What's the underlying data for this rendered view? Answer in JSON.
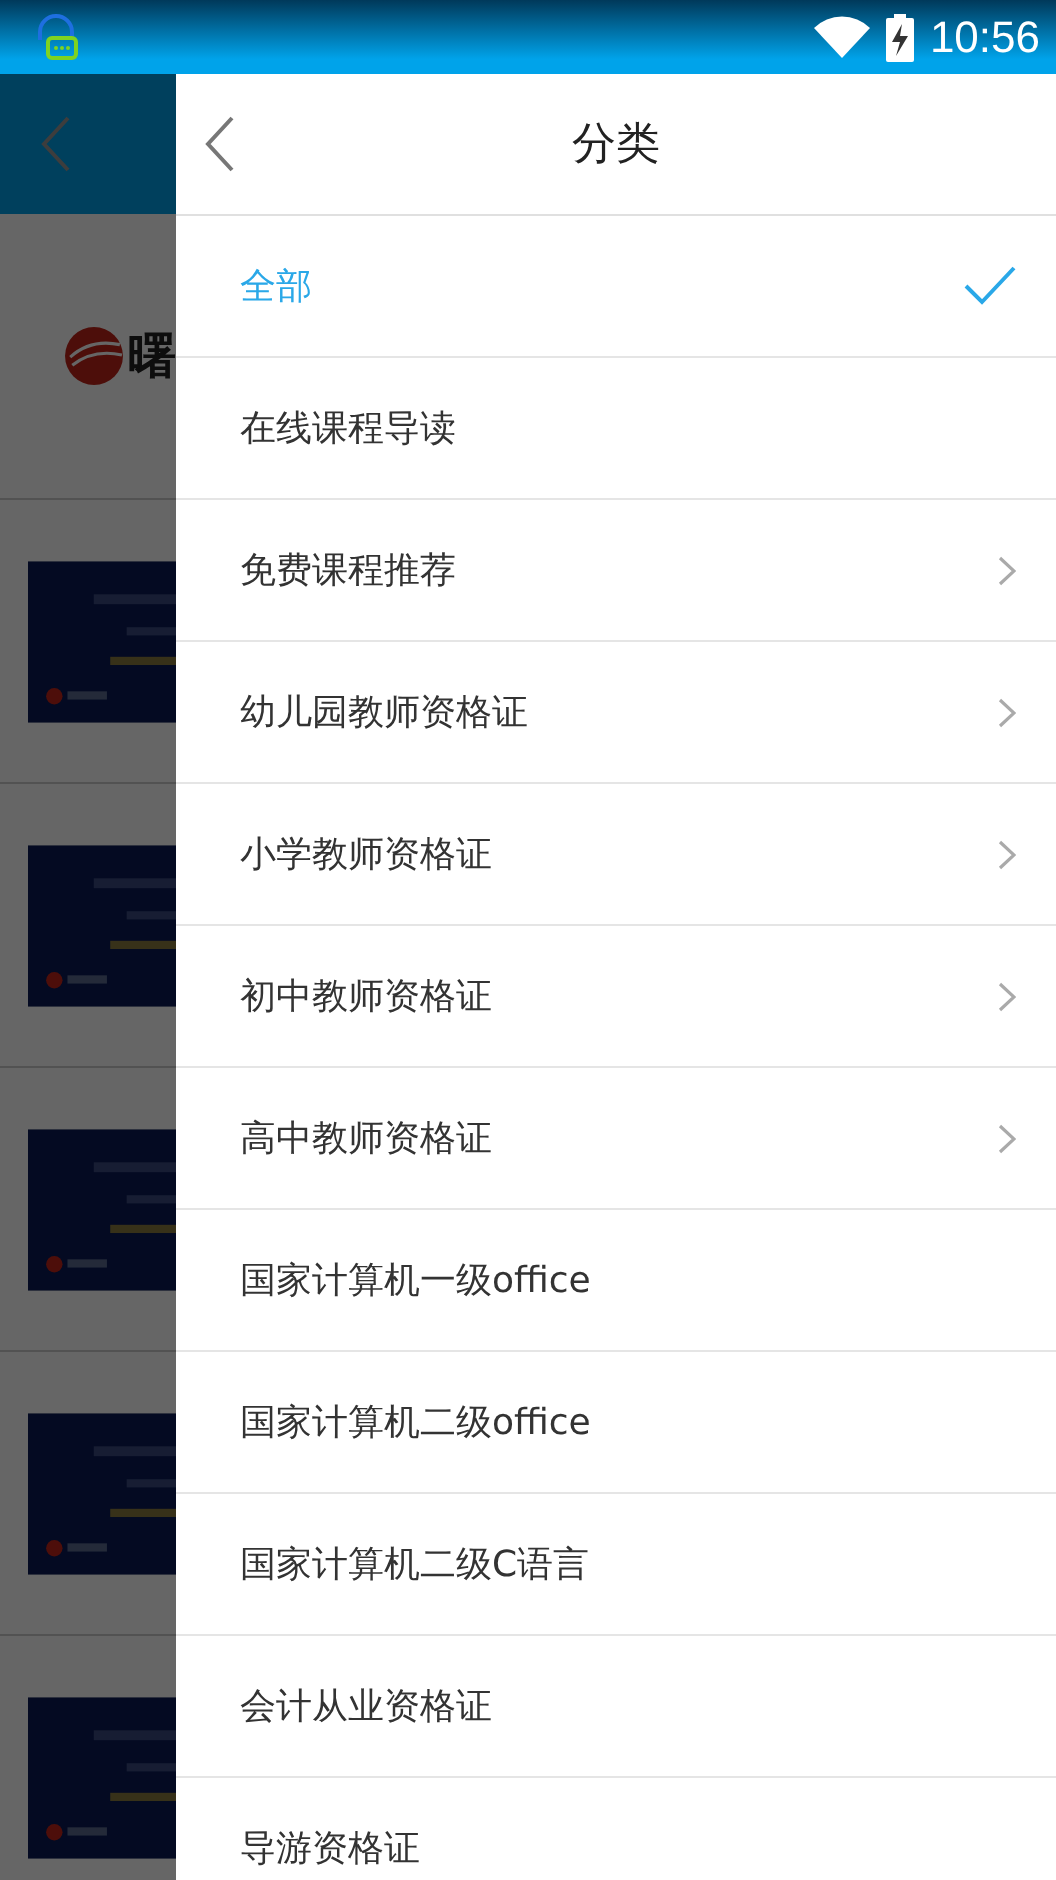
{
  "status_bar": {
    "time": "10:56"
  },
  "background": {
    "logo_text": "曙"
  },
  "drawer": {
    "title": "分类",
    "items": [
      {
        "label": "全部",
        "selected": true,
        "expandable": false
      },
      {
        "label": "在线课程导读",
        "selected": false,
        "expandable": false
      },
      {
        "label": "免费课程推荐",
        "selected": false,
        "expandable": true
      },
      {
        "label": "幼儿园教师资格证",
        "selected": false,
        "expandable": true
      },
      {
        "label": "小学教师资格证",
        "selected": false,
        "expandable": true
      },
      {
        "label": "初中教师资格证",
        "selected": false,
        "expandable": true
      },
      {
        "label": "高中教师资格证",
        "selected": false,
        "expandable": true
      },
      {
        "label": "国家计算机一级office",
        "selected": false,
        "expandable": false
      },
      {
        "label": "国家计算机二级office",
        "selected": false,
        "expandable": false
      },
      {
        "label": "国家计算机二级C语言",
        "selected": false,
        "expandable": false
      },
      {
        "label": "会计从业资格证",
        "selected": false,
        "expandable": false
      },
      {
        "label": "导游资格证",
        "selected": false,
        "expandable": false
      }
    ]
  }
}
